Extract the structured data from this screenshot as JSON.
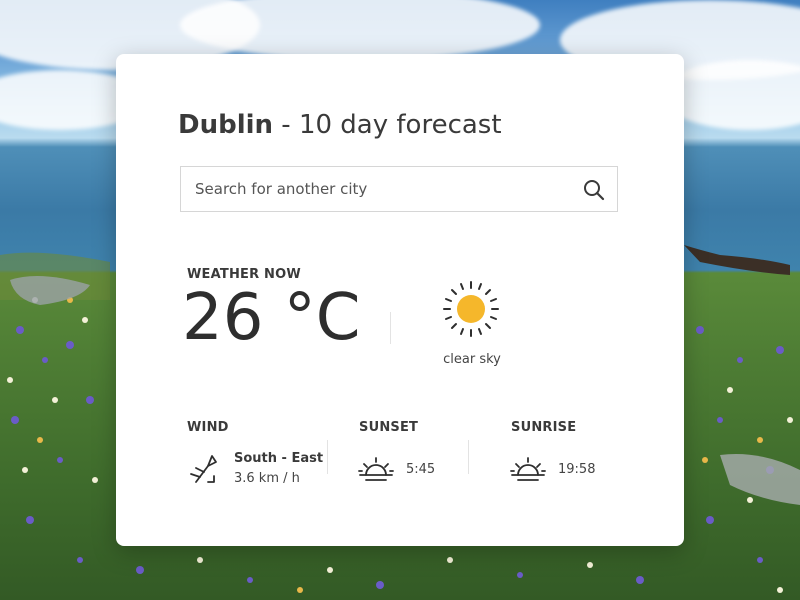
{
  "header": {
    "city": "Dublin",
    "title_suffix": " - 10 day forecast"
  },
  "search": {
    "placeholder": "Search for another city",
    "icon": "search-icon"
  },
  "weather_now": {
    "label": "WEATHER NOW",
    "temperature": "26 °C",
    "condition": "clear sky",
    "icon": "sun-icon"
  },
  "wind": {
    "label": "WIND",
    "direction": "South - East",
    "speed": "3.6 km / h",
    "icon": "wind-icon"
  },
  "sunset": {
    "label": "SUNSET",
    "time": "5:45",
    "icon": "sunset-icon"
  },
  "sunrise": {
    "label": "SUNRISE",
    "time": "19:58",
    "icon": "sunrise-icon"
  },
  "colors": {
    "sun": "#f5b72b",
    "text": "#3a3a3a",
    "card": "#ffffff"
  }
}
